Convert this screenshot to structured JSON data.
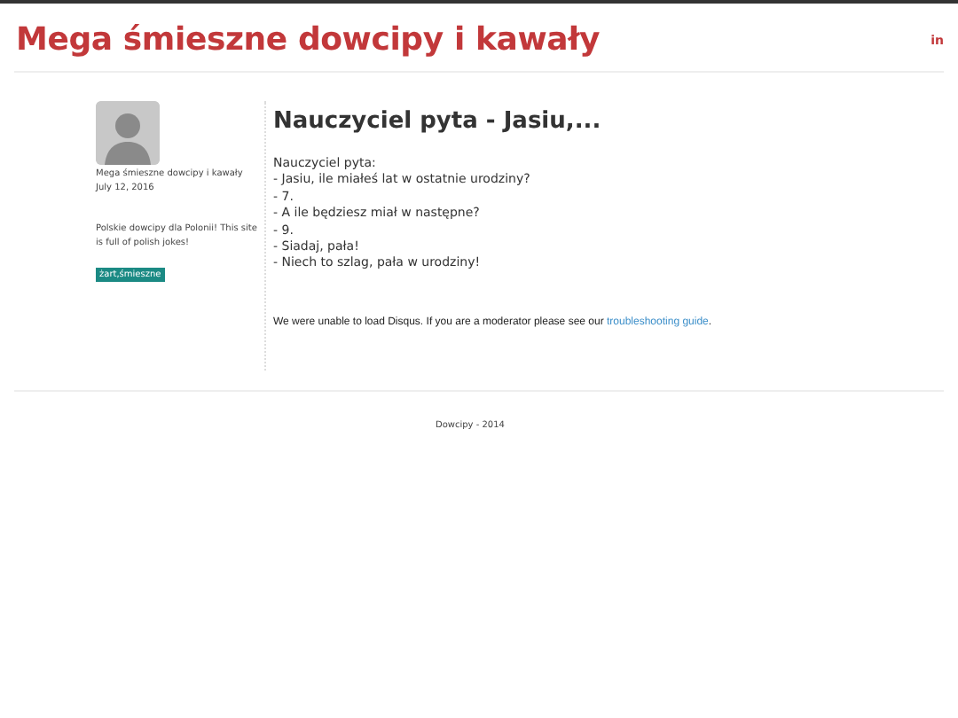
{
  "header": {
    "title": "Mega śmieszne dowcipy i kawały",
    "social_icon": "in"
  },
  "sidebar": {
    "author": "Mega śmieszne dowcipy i kawały",
    "date": "July 12, 2016",
    "description": "Polskie dowcipy dla Polonii! This site is full of polish jokes!",
    "tags": [
      "żart,śmieszne"
    ]
  },
  "post": {
    "title": "Nauczyciel pyta - Jasiu,...",
    "lines": [
      "Nauczyciel pyta:",
      "- Jasiu, ile miałeś lat w ostatnie urodziny?",
      "- 7.",
      "- A ile będziesz miał w następne?",
      "- 9.",
      "- Siadaj, pała!",
      "- Niech to szlag, pała w urodziny!"
    ],
    "comments_notice": {
      "text": "We were unable to load Disqus. If you are a moderator please see our ",
      "link": "troubleshooting guide",
      "after": "."
    }
  },
  "footer": {
    "text": "Dowcipy - 2014"
  }
}
